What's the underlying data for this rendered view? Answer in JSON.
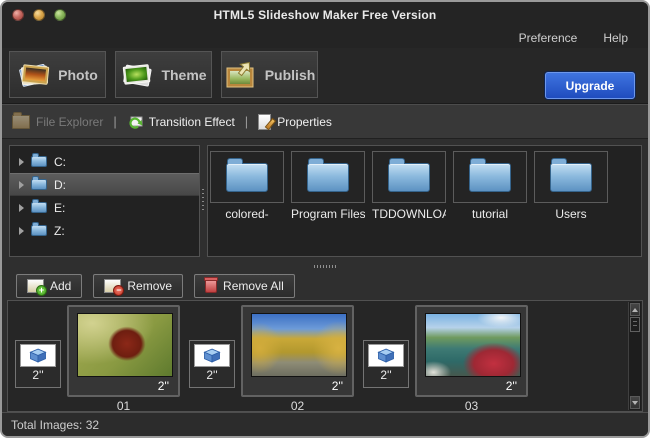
{
  "window": {
    "title": "HTML5 Slideshow Maker Free Version"
  },
  "menu": {
    "preference": "Preference",
    "help": "Help"
  },
  "tabs": {
    "photo": "Photo",
    "theme": "Theme",
    "publish": "Publish"
  },
  "upgrade": {
    "label": "Upgrade",
    "accent_color": "#2a57c8"
  },
  "toolbar": {
    "file_explorer": "File Explorer",
    "transition_effect": "Transition Effect",
    "properties": "Properties"
  },
  "drives": {
    "items": [
      {
        "label": "C:",
        "selected": false
      },
      {
        "label": "D:",
        "selected": true
      },
      {
        "label": "E:",
        "selected": false
      },
      {
        "label": "Z:",
        "selected": false
      }
    ]
  },
  "folders": {
    "items": [
      {
        "label": "colored-"
      },
      {
        "label": "Program Files"
      },
      {
        "label": "TDDOWNLOA"
      },
      {
        "label": "tutorial"
      },
      {
        "label": "Users"
      }
    ]
  },
  "actions": {
    "add": "Add",
    "remove": "Remove",
    "remove_all": "Remove All"
  },
  "timeline": {
    "items": [
      {
        "number": "01",
        "duration": "2''",
        "transition_duration": "2''",
        "photo": "red-flower-macro"
      },
      {
        "number": "02",
        "duration": "2''",
        "transition_duration": "2''",
        "photo": "autumn-trees-path"
      },
      {
        "number": "03",
        "duration": "2''",
        "transition_duration": "2''",
        "photo": "lakeside-red-flowers"
      }
    ]
  },
  "status": {
    "total_images": "Total Images: 32"
  }
}
